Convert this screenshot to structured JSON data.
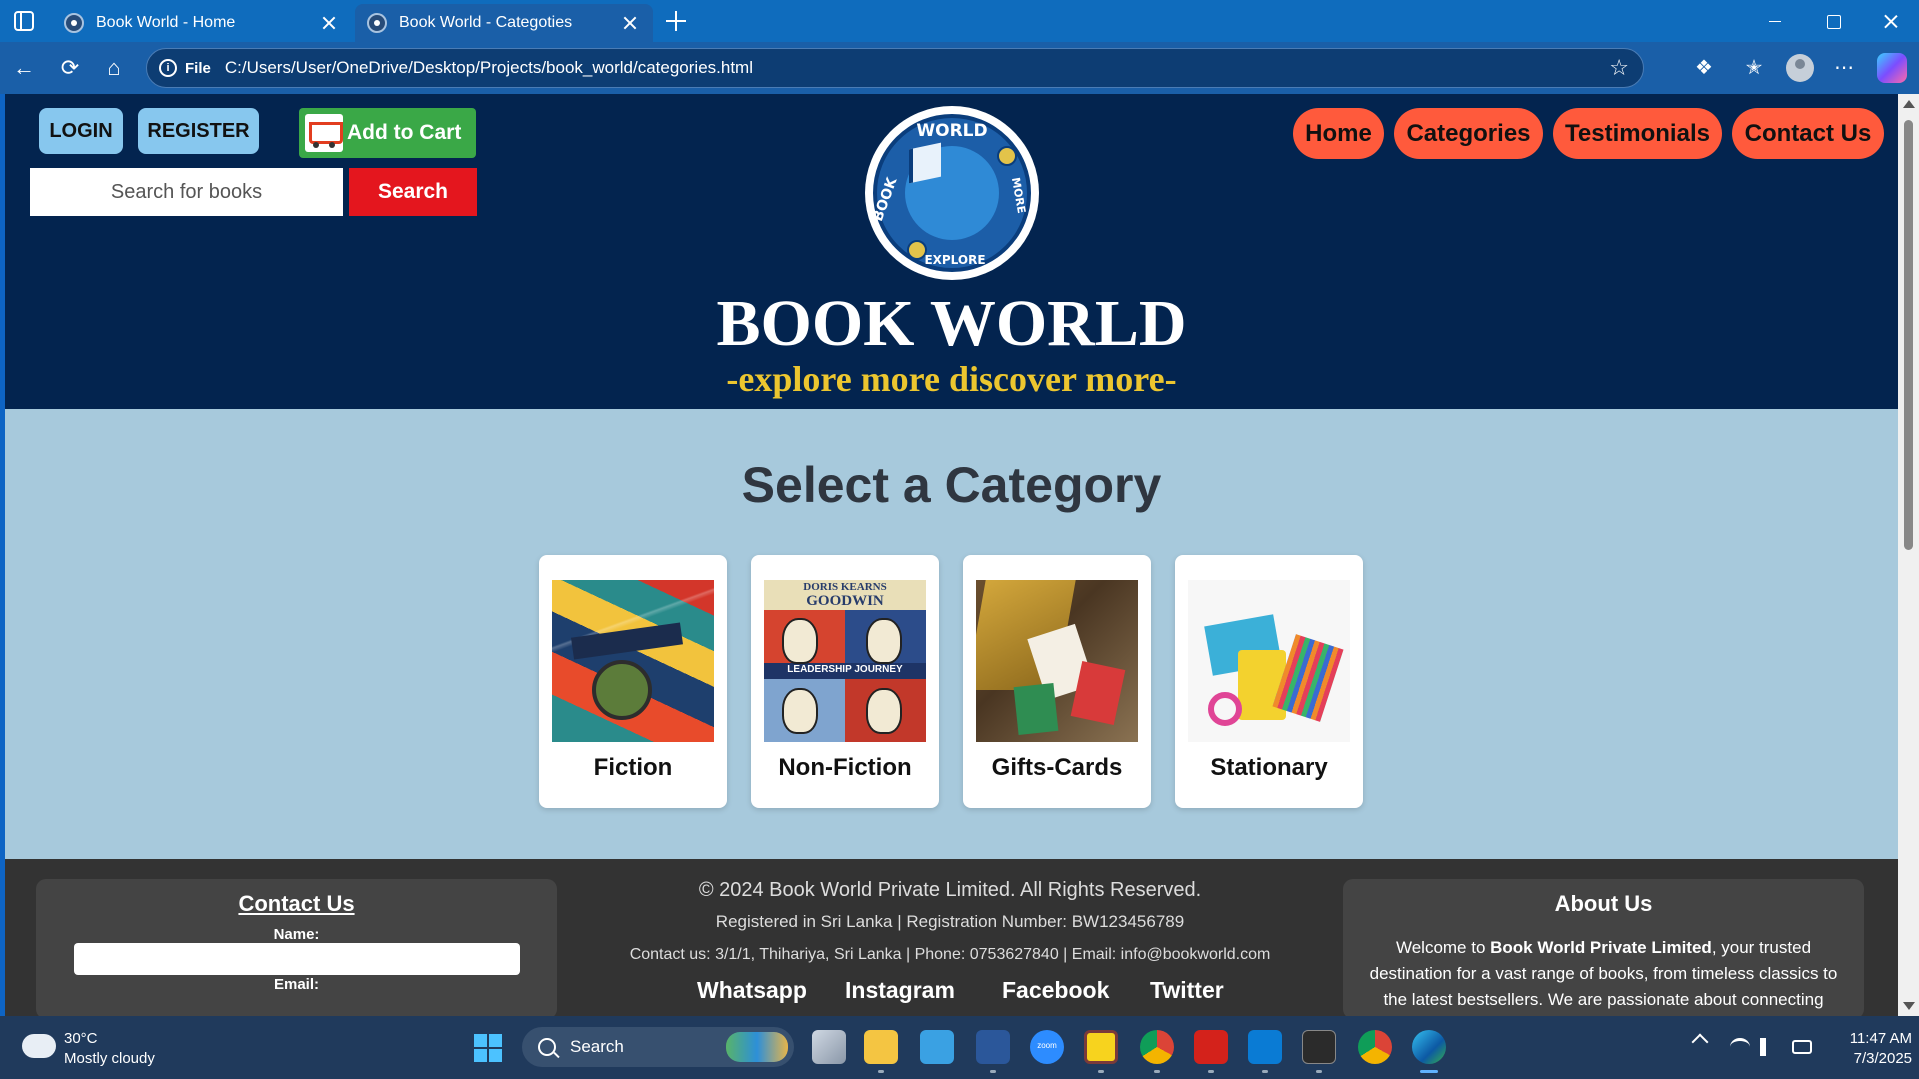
{
  "browser": {
    "tabs": [
      {
        "title": "Book World - Home"
      },
      {
        "title": "Book World - Categoties"
      }
    ],
    "address": {
      "scheme_label": "File",
      "url": "C:/Users/User/OneDrive/Desktop/Projects/book_world/categories.html"
    },
    "icons": [
      "back-icon",
      "refresh-icon",
      "home-icon",
      "star-icon",
      "extensions-icon",
      "favorites-icon",
      "profile-icon",
      "more-icon",
      "copilot-icon"
    ]
  },
  "header": {
    "login_label": "LOGIN",
    "register_label": "REGISTER",
    "cart_label": "Add to Cart",
    "search_placeholder": "Search for books",
    "search_button": "Search",
    "logo_ring_top": "WORLD",
    "logo_ring_left": "BOOK",
    "logo_ring_right": "MORE",
    "logo_ring_bottom": "EXPLORE",
    "title": "BOOK WORLD",
    "tagline": "-explore more discover more-",
    "nav": [
      "Home",
      "Categories",
      "Testimonials",
      "Contact Us"
    ]
  },
  "main": {
    "title": "Select a Category",
    "categories": [
      {
        "label": "Fiction"
      },
      {
        "label": "Non-Fiction",
        "cover_lines": [
          "DORIS KEARNS",
          "GOODWIN",
          "LEADERSHIP JOURNEY"
        ]
      },
      {
        "label": "Gifts-Cards"
      },
      {
        "label": "Stationary"
      }
    ]
  },
  "footer": {
    "contact": {
      "title": "Contact Us",
      "name_label": "Name:",
      "email_label": "Email:"
    },
    "copyright": "© 2024 Book World Private Limited. All Rights Reserved.",
    "registration": "Registered in Sri Lanka | Registration Number: BW123456789",
    "contact_line": "Contact us: 3/1/1, Thihariya, Sri Lanka | Phone: 0753627840 | Email: info@bookworld.com",
    "social": [
      "Whatsapp",
      "Instagram",
      "Facebook",
      "Twitter"
    ],
    "about": {
      "title": "About Us",
      "text_intro": "Welcome to ",
      "company": "Book World Private Limited",
      "text_rest": ", your trusted destination for a vast range of books, from timeless classics to the latest bestsellers. We are passionate about connecting"
    }
  },
  "taskbar": {
    "weather_temp": "30°C",
    "weather_desc": "Mostly cloudy",
    "search_label": "Search",
    "zoom_label": "zoom",
    "time": "11:47 AM",
    "date": "7/3/2025"
  },
  "colors": {
    "header_bg": "#03244f",
    "page_bg": "#a7c9dc",
    "nav_pill": "#ff5a3c",
    "search_button": "#e4161e",
    "cart_button": "#3aa847",
    "tagline": "#ecc62f",
    "footer_bg": "#333333"
  }
}
